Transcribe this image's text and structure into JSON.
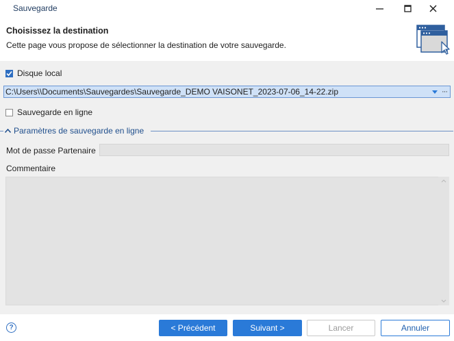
{
  "window": {
    "title": "Sauvegarde",
    "minimize_glyph": "—",
    "maximize_glyph": "☐",
    "close_glyph": "✕"
  },
  "header": {
    "title": "Choisissez la destination",
    "subtitle": "Cette page vous propose de sélectionner la destination de votre sauvegarde.",
    "icon": "window-cursor-icon"
  },
  "local": {
    "label": "Disque local",
    "checked": true,
    "path": "C:\\Users\\\\Documents\\Sauvegardes\\Sauvegarde_DEMO VAISONET_2023-07-06_14-22.zip",
    "more_label": "···"
  },
  "online": {
    "label": "Sauvegarde en ligne",
    "checked": false
  },
  "section": {
    "title": "Paramètres de sauvegarde en ligne",
    "expanded": true
  },
  "form": {
    "password_label": "Mot de passe Partenaire",
    "password_value": "",
    "comment_label": "Commentaire",
    "comment_value": ""
  },
  "footer": {
    "help_label": "?",
    "previous_label": "< Précédent",
    "next_label": "Suivant >",
    "launch_label": "Lancer",
    "cancel_label": "Annuler"
  },
  "colors": {
    "accent": "#2a7ad8",
    "section_text": "#1f4e8c",
    "path_selection": "#cfe1f7"
  }
}
